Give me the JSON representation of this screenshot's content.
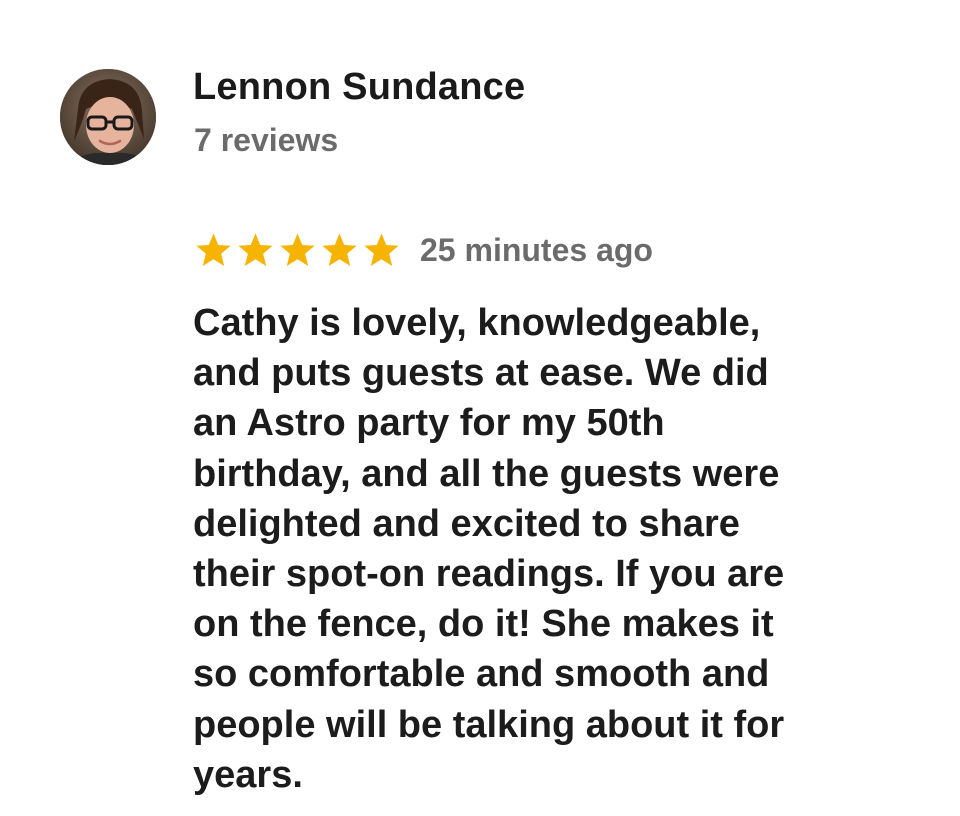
{
  "reviewer": {
    "name": "Lennon Sundance",
    "review_count": "7 reviews",
    "avatar_icon": "reviewer-photo"
  },
  "rating": {
    "stars": 5,
    "max_stars": 5,
    "star_color": "#f6b300",
    "star_icon": "star-icon"
  },
  "timestamp": "25 minutes ago",
  "review_lines": [
    "Cathy is lovely, knowledgeable,",
    "and puts guests at ease. We did",
    "an Astro party for my 50th",
    "birthday, and all the guests were",
    "delighted and excited to share",
    "their spot-on readings. If you are",
    "on the fence, do it! She makes it",
    "so comfortable and smooth and",
    "people will be talking about it for",
    "years."
  ]
}
